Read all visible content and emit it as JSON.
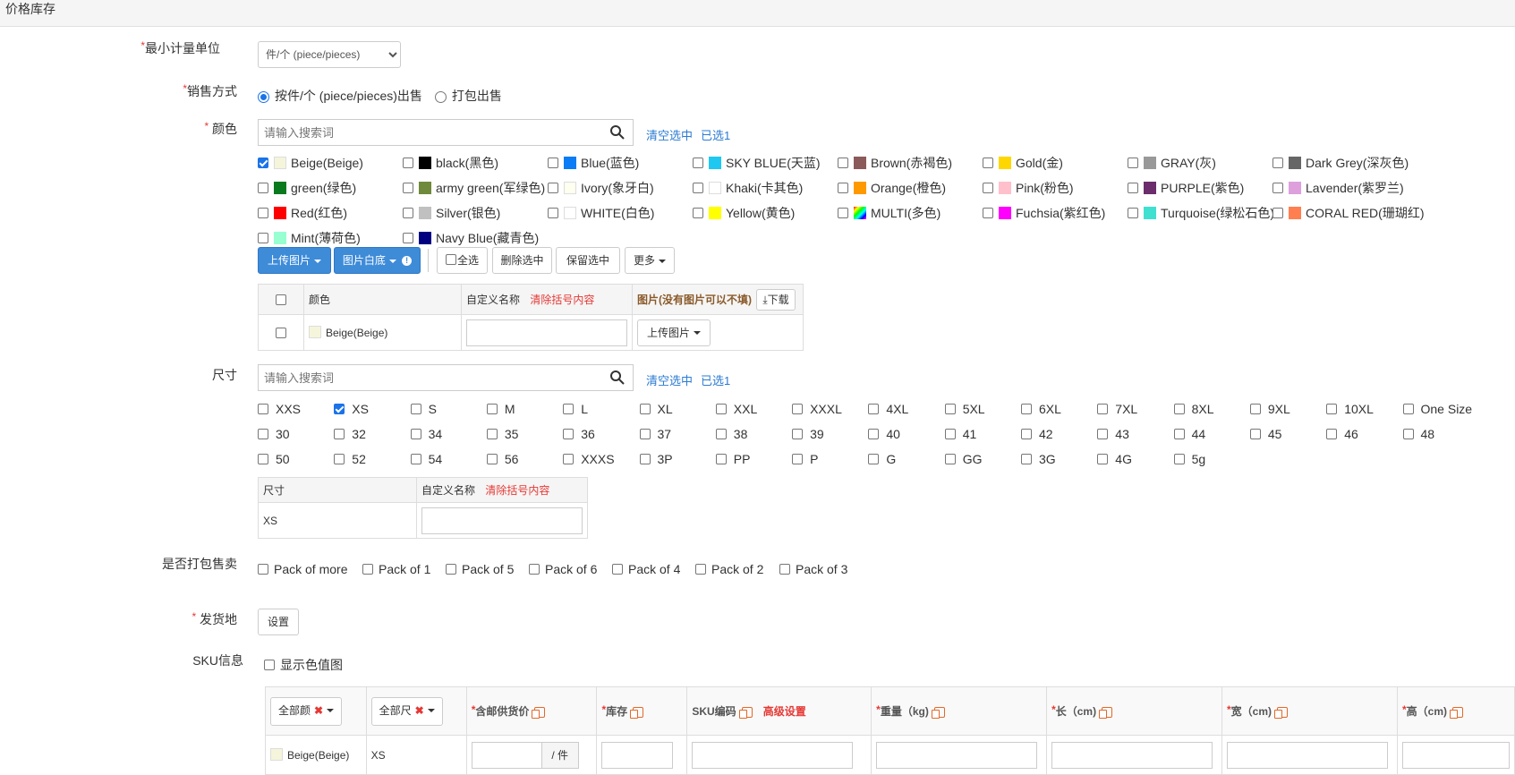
{
  "section_title": "价格库存",
  "unit": {
    "label": "最小计量单位",
    "value": "件/个 (piece/pieces)"
  },
  "sale_method": {
    "label": "销售方式",
    "options": [
      "按件/个 (piece/pieces)出售",
      "打包出售"
    ]
  },
  "color": {
    "label": "颜色",
    "search_placeholder": "请输入搜索词",
    "clear_link": "清空选中",
    "selected_link": "已选1",
    "options": [
      {
        "name": "Beige(Beige)",
        "color": "#f5f5dc",
        "checked": true
      },
      {
        "name": "black(黑色)",
        "color": "#000000"
      },
      {
        "name": "Blue(蓝色)",
        "color": "#0a7cf5"
      },
      {
        "name": "SKY BLUE(天蓝)",
        "color": "#1ec8f0"
      },
      {
        "name": "Brown(赤褐色)",
        "color": "#8b5a5a"
      },
      {
        "name": "Gold(金)",
        "color": "#ffd700"
      },
      {
        "name": "GRAY(灰)",
        "color": "#999999"
      },
      {
        "name": "Dark Grey(深灰色)",
        "color": "#666666"
      },
      {
        "name": "green(绿色)",
        "color": "#0a7a1e"
      },
      {
        "name": "army green(军绿色)",
        "color": "#6f8a3a"
      },
      {
        "name": "Ivory(象牙白)",
        "color": "#fffff0"
      },
      {
        "name": "Khaki(卡其色)",
        "color": "#ffffff"
      },
      {
        "name": "Orange(橙色)",
        "color": "#ff9900"
      },
      {
        "name": "Pink(粉色)",
        "color": "#ffc0cb"
      },
      {
        "name": "PURPLE(紫色)",
        "color": "#6b2d6b"
      },
      {
        "name": "Lavender(紫罗兰)",
        "color": "#dda0dd"
      },
      {
        "name": "Red(红色)",
        "color": "#ff0000"
      },
      {
        "name": "Silver(银色)",
        "color": "#c0c0c0"
      },
      {
        "name": "WHITE(白色)",
        "color": "#ffffff"
      },
      {
        "name": "Yellow(黄色)",
        "color": "#ffff00"
      },
      {
        "name": "MULTI(多色)",
        "color": "multi"
      },
      {
        "name": "Fuchsia(紫红色)",
        "color": "#ff00ff"
      },
      {
        "name": "Turquoise(绿松石色)",
        "color": "#40e0d0"
      },
      {
        "name": "CORAL RED(珊瑚红)",
        "color": "#ff7f50"
      },
      {
        "name": "Mint(薄荷色)",
        "color": "#98ffd0"
      },
      {
        "name": "Navy Blue(藏青色)",
        "color": "#000080"
      }
    ],
    "toolbar": {
      "upload": "上传图片",
      "white_bg": "图片白底",
      "select_all": "全选",
      "delete_selected": "删除选中",
      "keep_selected": "保留选中",
      "more": "更多"
    },
    "table": {
      "col_color": "颜色",
      "col_custom": "自定义名称",
      "clear_brackets": "清除括号内容",
      "col_image": "图片(没有图片可以不填)",
      "download": "下载",
      "rows": [
        {
          "name": "Beige(Beige)",
          "color": "#f5f5dc",
          "upload": "上传图片"
        }
      ]
    }
  },
  "size": {
    "label": "尺寸",
    "search_placeholder": "请输入搜索词",
    "clear_link": "清空选中",
    "selected_link": "已选1",
    "options": [
      {
        "name": "XXS"
      },
      {
        "name": "XS",
        "checked": true
      },
      {
        "name": "S"
      },
      {
        "name": "M"
      },
      {
        "name": "L"
      },
      {
        "name": "XL"
      },
      {
        "name": "XXL"
      },
      {
        "name": "XXXL"
      },
      {
        "name": "4XL"
      },
      {
        "name": "5XL"
      },
      {
        "name": "6XL"
      },
      {
        "name": "7XL"
      },
      {
        "name": "8XL"
      },
      {
        "name": "9XL"
      },
      {
        "name": "10XL"
      },
      {
        "name": "One Size"
      },
      {
        "name": "30"
      },
      {
        "name": "32"
      },
      {
        "name": "34"
      },
      {
        "name": "35"
      },
      {
        "name": "36"
      },
      {
        "name": "37"
      },
      {
        "name": "38"
      },
      {
        "name": "39"
      },
      {
        "name": "40"
      },
      {
        "name": "41"
      },
      {
        "name": "42"
      },
      {
        "name": "43"
      },
      {
        "name": "44"
      },
      {
        "name": "45"
      },
      {
        "name": "46"
      },
      {
        "name": "48"
      },
      {
        "name": "50"
      },
      {
        "name": "52"
      },
      {
        "name": "54"
      },
      {
        "name": "56"
      },
      {
        "name": "XXXS"
      },
      {
        "name": "3P"
      },
      {
        "name": "PP"
      },
      {
        "name": "P"
      },
      {
        "name": "G"
      },
      {
        "name": "GG"
      },
      {
        "name": "3G"
      },
      {
        "name": "4G"
      },
      {
        "name": "5g"
      }
    ],
    "table": {
      "col_size": "尺寸",
      "col_custom": "自定义名称",
      "clear_brackets": "清除括号内容",
      "rows": [
        {
          "name": "XS"
        }
      ]
    }
  },
  "pack": {
    "label": "是否打包售卖",
    "options": [
      "Pack of more",
      "Pack of 1",
      "Pack of 5",
      "Pack of 6",
      "Pack of 4",
      "Pack of 2",
      "Pack of 3"
    ]
  },
  "ship_from": {
    "label": "发货地",
    "button": "设置"
  },
  "sku": {
    "label": "SKU信息",
    "show_color_image": "显示色值图",
    "all_colors": "全部颜",
    "all_sizes": "全部尺",
    "headers": [
      "含邮供货价",
      "库存",
      "SKU编码",
      "重量（kg)",
      "长（cm)",
      "宽（cm)",
      "高（cm)"
    ],
    "advanced": "高级设置",
    "per_unit": "/ 件",
    "rows": [
      {
        "color": "Beige(Beige)",
        "swatch": "#f5f5dc",
        "size": "XS"
      }
    ]
  }
}
